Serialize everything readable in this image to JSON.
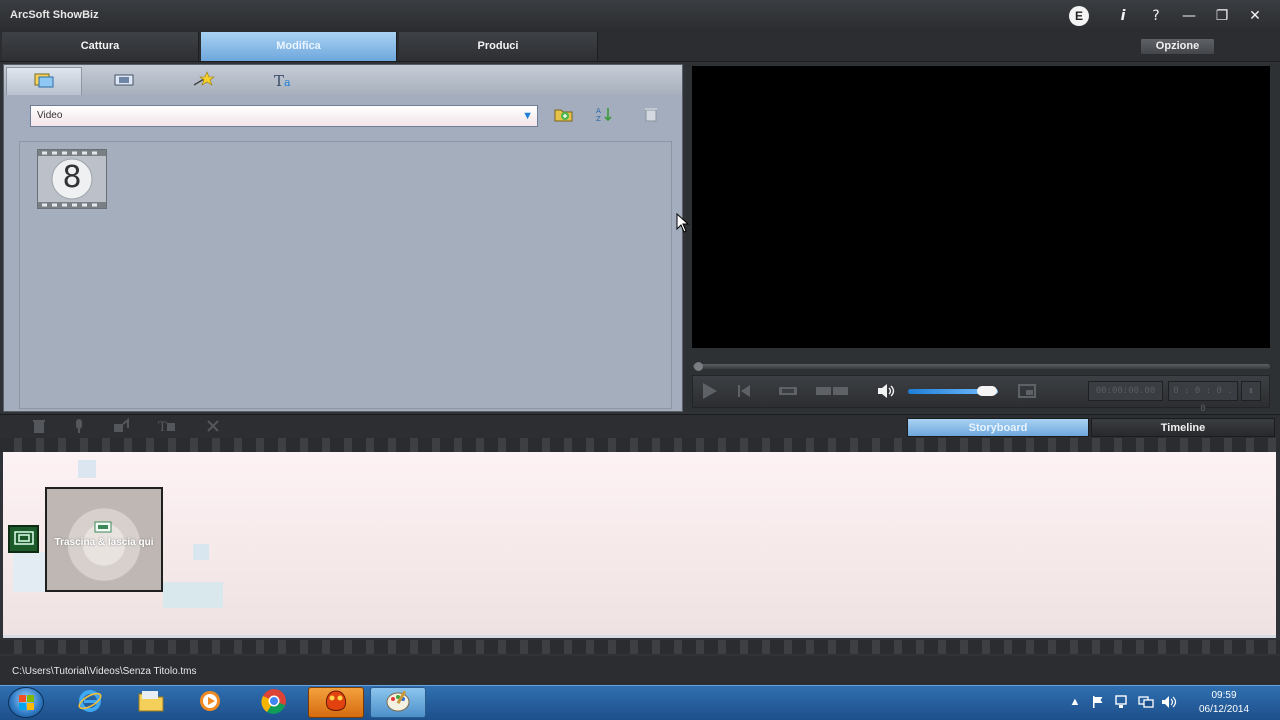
{
  "window": {
    "title": "ArcSoft ShowBiz",
    "e_badge": "E",
    "info_label": "i",
    "help_label": "?",
    "minimize_label": "—",
    "restore_label": "❐",
    "close_label": "✕"
  },
  "main_tabs": [
    {
      "label": "Cattura",
      "active": false
    },
    {
      "label": "Modifica",
      "active": true
    },
    {
      "label": "Produci",
      "active": false
    }
  ],
  "option_button": "Opzione",
  "media_panel": {
    "tabs": [
      "media-library-icon",
      "film-frame-icon",
      "effects-star-icon",
      "text-title-icon"
    ],
    "dropdown_value": "Video",
    "thumbnail_label": "8",
    "tools": [
      "add-folder-icon",
      "sort-icon",
      "trash-icon"
    ]
  },
  "player": {
    "timecode": "00:00:00.00",
    "timecode2": "0 : 0 : 0 . 0"
  },
  "storyboard": {
    "view_tabs": [
      {
        "label": "Storyboard",
        "active": true
      },
      {
        "label": "Timeline",
        "active": false
      }
    ],
    "drop_hint": "Trascina & lascia qui"
  },
  "status": {
    "path": "C:\\Users\\Tutorial\\Videos\\Senza Titolo.tms"
  },
  "taskbar": {
    "apps": [
      "ie-icon",
      "explorer-icon",
      "media-player-icon",
      "chrome-icon",
      "showbiz-icon",
      "paint-icon"
    ],
    "time": "09:59",
    "date": "06/12/2014"
  }
}
